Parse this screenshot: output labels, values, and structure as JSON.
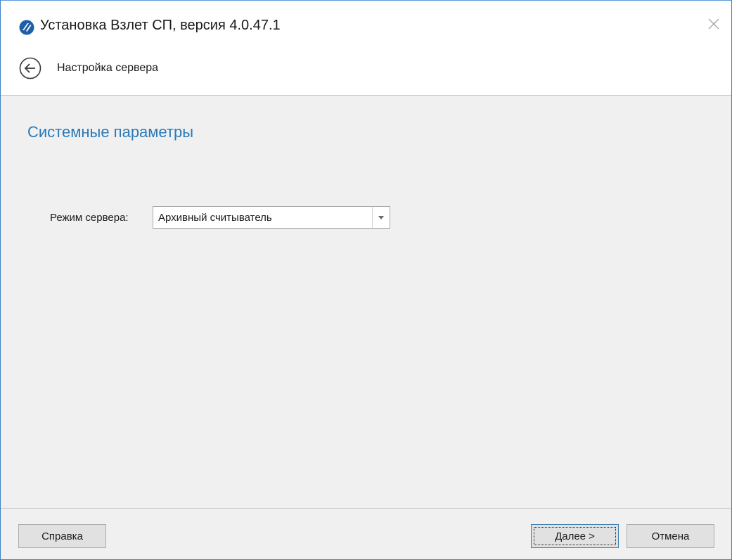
{
  "window": {
    "title": "Установка Взлет СП, версия 4.0.47.1"
  },
  "header": {
    "step_title": "Настройка сервера"
  },
  "main": {
    "section_title": "Системные параметры",
    "server_mode": {
      "label": "Режим сервера:",
      "value": "Архивный считыватель"
    }
  },
  "footer": {
    "help_label": "Справка",
    "next_label": "Далее >",
    "cancel_label": "Отмена"
  },
  "colors": {
    "accent": "#2a7ab8",
    "window_border": "#3c80c6",
    "background": "#f0f0f0"
  },
  "icons": {
    "app": "app-logo-icon",
    "close": "close-icon",
    "back": "back-arrow-icon",
    "dropdown": "chevron-down-icon"
  }
}
